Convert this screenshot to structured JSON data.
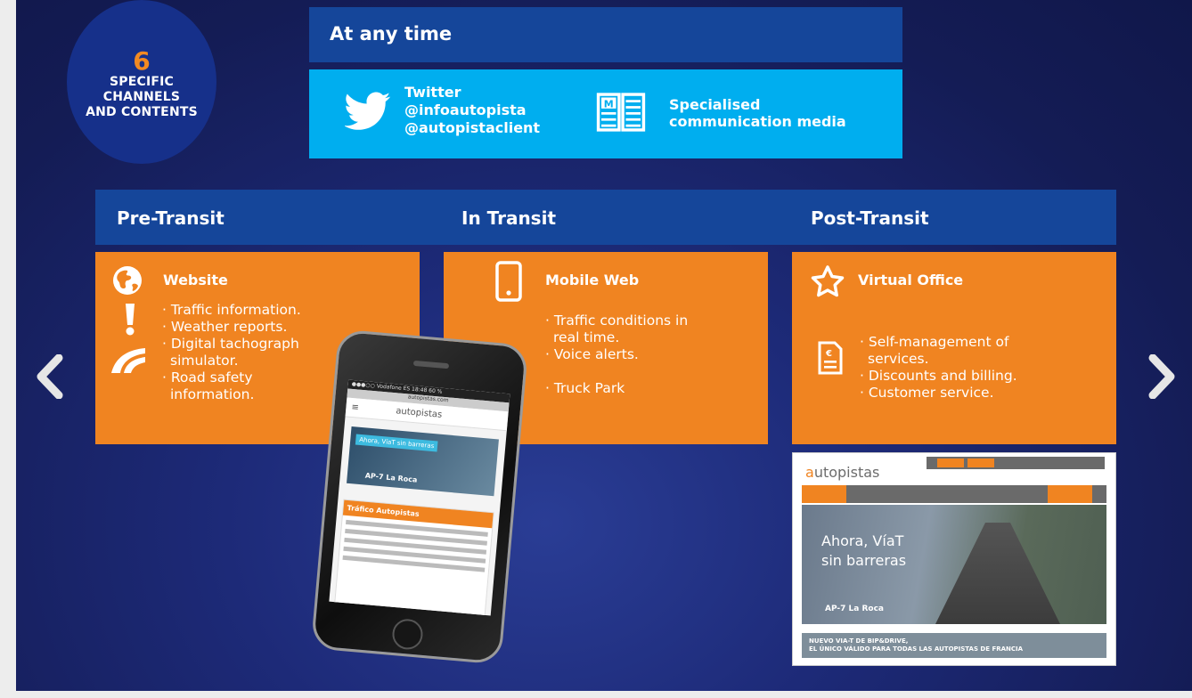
{
  "badge": {
    "number": "6",
    "line1": "SPECIFIC",
    "line2": "CHANNELS",
    "line3": "AND CONTENTS"
  },
  "anytime": {
    "title": "At any time",
    "twitter": {
      "icon": "twitter-bird-icon",
      "line1": "Twitter",
      "line2": "@infoautopista",
      "line3": "@autopistaclient"
    },
    "media": {
      "icon": "newspaper-icon",
      "line1": "Specialised",
      "line2": "communication media"
    }
  },
  "stages": {
    "pre": {
      "title": "Pre-Transit",
      "card_title": "Website",
      "icons": [
        "globe-icon",
        "exclamation-icon",
        "road-icon"
      ],
      "items": [
        [
          "Traffic information."
        ],
        [
          "Weather reports."
        ],
        [
          "Digital tachograph",
          "simulator."
        ],
        [
          "Road safety",
          "information."
        ]
      ]
    },
    "in": {
      "title": "In Transit",
      "card_title": "Mobile Web",
      "icons": [
        "mobile-phone-icon"
      ],
      "items": [
        [
          "Traffic conditions in",
          "real time."
        ],
        [
          "Voice alerts."
        ],
        [
          "Truck Park"
        ]
      ]
    },
    "post": {
      "title": "Post-Transit",
      "card_title": "Virtual Office",
      "icons": [
        "star-icon",
        "invoice-icon"
      ],
      "items": [
        [
          "Self-management of",
          "services."
        ],
        [
          "Discounts and billing."
        ],
        [
          "Customer service."
        ]
      ]
    }
  },
  "phone": {
    "status": "●●●○○ Vodafone ES  18:48  60 %",
    "url": "autopistas.com",
    "logo": "autopistas",
    "banner_tag": "Ahora, VíaT sin barreras",
    "banner_caption": "AP-7 La Roca",
    "feed_title": "Tráfico Autopistas"
  },
  "website": {
    "logo_a": "a",
    "logo_rest": "utopistas",
    "hero_line1": "Ahora, VíaT",
    "hero_line2": "sin barreras",
    "hero_caption": "AP-7 La Roca",
    "footer_line1": "NUEVO VIA-T DE BIP&DRIVE,",
    "footer_line2": "EL ÚNICO VÁLIDO PARA TODAS LAS AUTOPISTAS DE FRANCIA"
  },
  "colors": {
    "background": "#141c55",
    "bar_blue": "#15469a",
    "sky_blue": "#00aeef",
    "orange": "#f08421"
  }
}
